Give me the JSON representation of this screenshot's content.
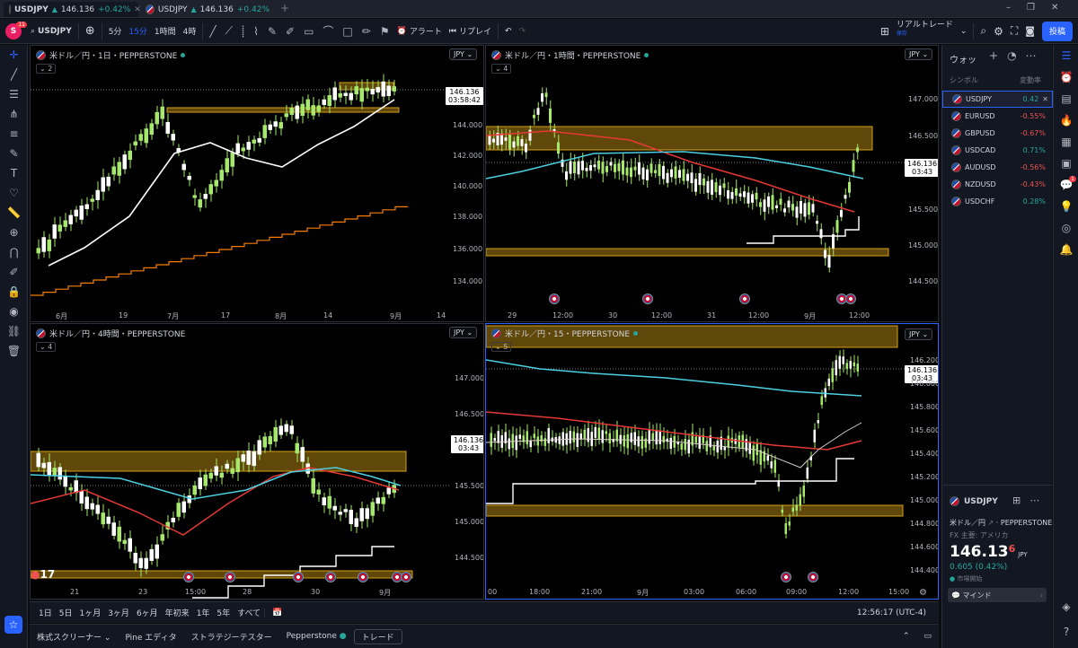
{
  "tabs": [
    {
      "symbol": "USDJPY",
      "price": "146.136",
      "change": "+0.42%",
      "active": true
    },
    {
      "symbol": "USDJPY",
      "price": "146.136",
      "change": "+0.42%",
      "active": false
    }
  ],
  "toolbar": {
    "avatar": "S",
    "avatar_badge": "11",
    "symbol": "USDJPY",
    "intervals": [
      "5分",
      "15分",
      "1時間",
      "4時"
    ],
    "alert": "アラート",
    "replay": "リプレイ",
    "layout_name": "リアルトレード",
    "layout_sub": "保存",
    "publish": "投稿"
  },
  "panes": [
    {
      "title": "米ドル／円・1日・PEPPERSTONE",
      "count": "2",
      "currency": "JPY",
      "yticks": [
        "144.000",
        "142.000",
        "140.000",
        "138.000",
        "136.000",
        "134.000"
      ],
      "xticks": [
        "6月",
        "19",
        "7月",
        "17",
        "8月",
        "14",
        "9月",
        "14"
      ],
      "price": "146.136",
      "countdown": "03:58:42"
    },
    {
      "title": "米ドル／円・1時間・PEPPERSTONE",
      "count": "4",
      "currency": "JPY",
      "yticks": [
        "147.000",
        "146.500",
        "145.500",
        "145.000",
        "144.500"
      ],
      "xticks": [
        "29",
        "12:00",
        "30",
        "12:00",
        "31",
        "12:00",
        "9月",
        "12:00"
      ],
      "price": "146.136",
      "countdown": "03:43"
    },
    {
      "title": "米ドル／円・4時間・PEPPERSTONE",
      "count": "4",
      "currency": "JPY",
      "yticks": [
        "147.000",
        "146.500",
        "145.500",
        "145.000",
        "144.500"
      ],
      "xticks": [
        "21",
        "23",
        "15:00",
        "28",
        "30",
        "9月"
      ],
      "price": "146.136",
      "countdown": "03:43"
    },
    {
      "title": "米ドル／円・15・PEPPERSTONE",
      "count": "5",
      "currency": "JPY",
      "yticks": [
        "146.200",
        "146.000",
        "145.800",
        "145.600",
        "145.400",
        "145.200",
        "145.000",
        "144.800",
        "144.600",
        "144.400"
      ],
      "xticks": [
        "00",
        "18:00",
        "21:00",
        "9月",
        "03:00",
        "06:00",
        "09:00",
        "12:00",
        "15:00"
      ],
      "price": "146.136",
      "countdown": "03:43"
    }
  ],
  "timeframes": [
    "1日",
    "5日",
    "1ヶ月",
    "3ヶ月",
    "6ヶ月",
    "年初来",
    "1年",
    "5年",
    "すべて"
  ],
  "clock": "12:56:17 (UTC-4)",
  "footer": [
    "株式スクリーナー",
    "Pine エディタ",
    "ストラテジーテスター",
    "Pepperstone",
    "トレード"
  ],
  "watchlist": {
    "title": "ウォッ",
    "col_symbol": "シンボル",
    "col_change": "変動率",
    "rows": [
      {
        "symbol": "USDJPY",
        "change": "0.42",
        "dir": "up"
      },
      {
        "symbol": "EURUSD",
        "change": "-0.55%",
        "dir": "dn"
      },
      {
        "symbol": "GBPUSD",
        "change": "-0.67%",
        "dir": "dn"
      },
      {
        "symbol": "USDCAD",
        "change": "0.71%",
        "dir": "up"
      },
      {
        "symbol": "AUDUSD",
        "change": "-0.56%",
        "dir": "dn"
      },
      {
        "symbol": "NZDUSD",
        "change": "-0.43%",
        "dir": "dn"
      },
      {
        "symbol": "USDCHF",
        "change": "0.28%",
        "dir": "up"
      }
    ]
  },
  "details": {
    "symbol": "USDJPY",
    "name": "米ドル／円",
    "source": "PEPPERSTONE",
    "market": "FX 主要: アメリカ",
    "price": "146.13",
    "price_small": "6",
    "unit": "JPY",
    "change": "0.605 (0.42%)",
    "status": "市場開始",
    "mind": "マインド"
  },
  "colors": {
    "up": "#26a69a",
    "down": "#ef5350",
    "zone": "#d4a017",
    "ma_white": "#ffffff",
    "ma_red": "#e53935",
    "ma_cyan": "#4dd0e1",
    "ma_orange": "#f57c00",
    "candle": "#a5e86a"
  }
}
